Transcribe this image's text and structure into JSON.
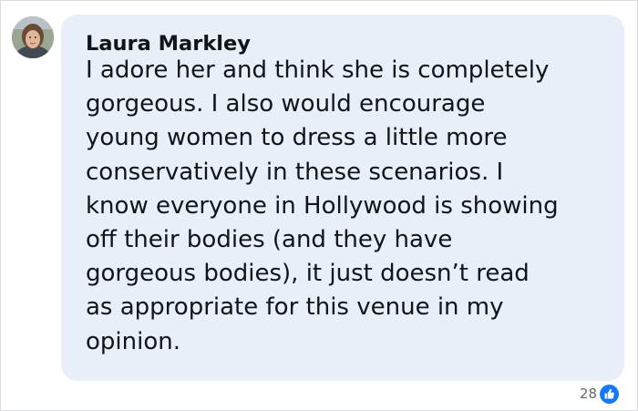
{
  "comment": {
    "author": "Laura Markley",
    "text": "I adore her and think she is completely\ngorgeous. I also would encourage\nyoung women to dress a little more\nconservatively in these scenarios. I\nknow everyone in Hollywood is showing\noff their bodies (and they have\ngorgeous bodies), it just doesn’t read\nas appropriate for this venue in my\nopinion.",
    "reactions": {
      "count": "28",
      "icon": "like-icon"
    }
  },
  "colors": {
    "bubble": "#e8eff8",
    "like_blue": "#1877f2",
    "meta_text": "#65676b"
  }
}
